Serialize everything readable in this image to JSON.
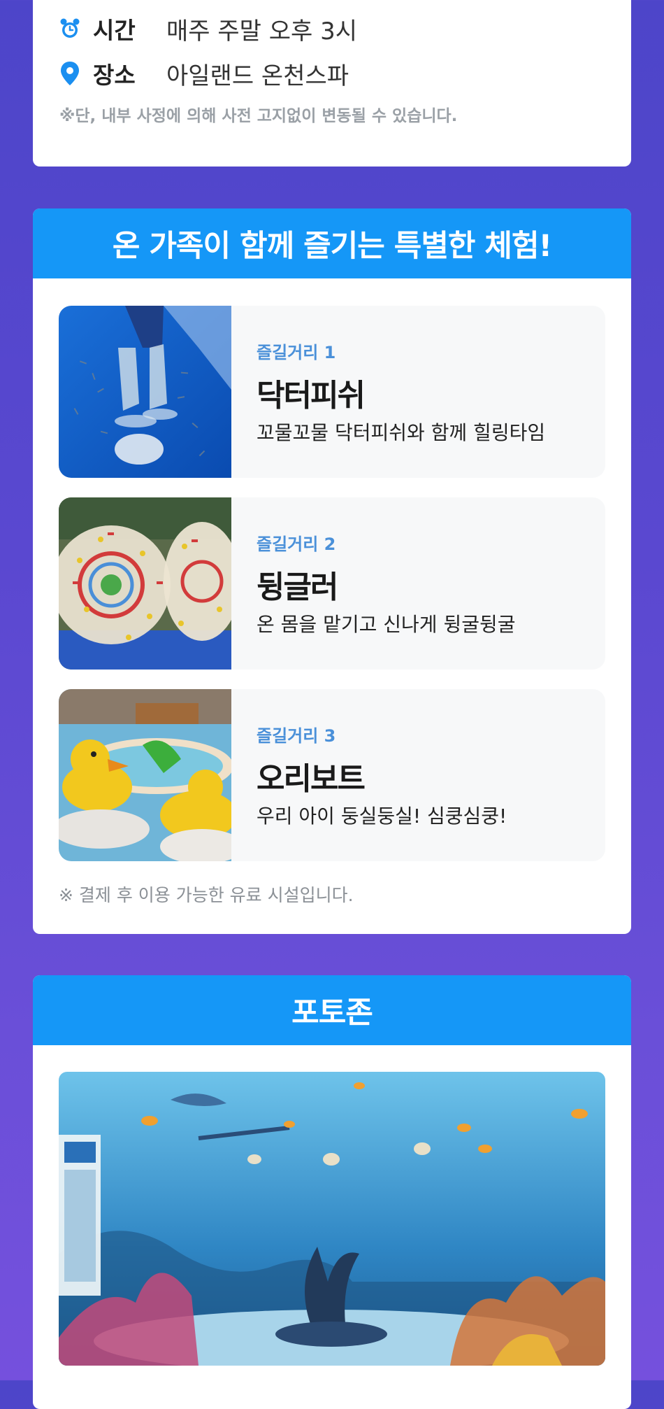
{
  "info": {
    "time_label": "시간",
    "time_value": "매주 주말 오후 3시",
    "place_label": "장소",
    "place_value": "아일랜드 온천스파",
    "notice": "※단, 내부 사정에 의해 사전 고지없이 변동될 수 있습니다.",
    "icons": [
      "alarm-clock-icon",
      "location-pin-icon"
    ],
    "accent_color": "#1b8ff0"
  },
  "experience": {
    "title": "온 가족이 함께 즐기는 특별한 체험!",
    "header_color": "#1597f7",
    "items": [
      {
        "sub": "즐길거리 1",
        "title": "닥터피쉬",
        "desc": "꼬물꼬물 닥터피쉬와 함께 힐링타임"
      },
      {
        "sub": "즐길거리 2",
        "title": "뒹글러",
        "desc": "온 몸을 맡기고 신나게 뒹굴뒹굴"
      },
      {
        "sub": "즐길거리 3",
        "title": "오리보트",
        "desc": "우리 아이 둥실둥실! 심쿵심쿵!"
      }
    ],
    "note": "※ 결제 후 이용 가능한 유료 시설입니다."
  },
  "photozone": {
    "title": "포토존"
  }
}
